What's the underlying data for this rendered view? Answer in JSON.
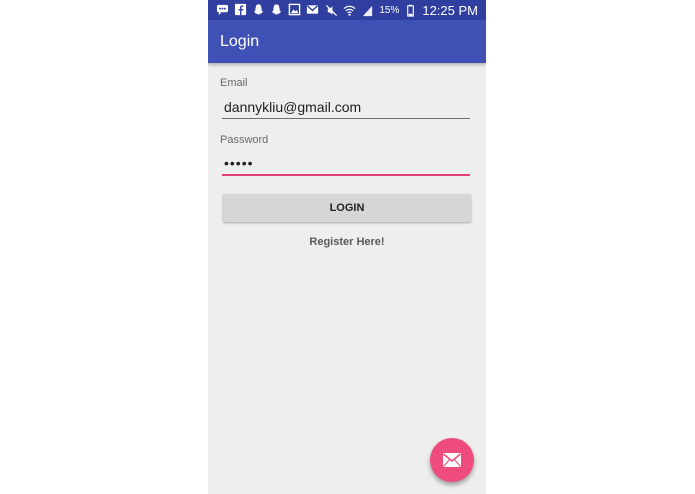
{
  "status_bar": {
    "battery": "15%",
    "time": "12:25 PM",
    "left_icons": [
      "messages-icon",
      "facebook-icon",
      "snapchat-icon",
      "snapchat-icon",
      "gallery-icon",
      "gmail-icon"
    ],
    "right_icons": [
      "mute-icon",
      "wifi-icon",
      "signal-icon",
      "battery-icon"
    ]
  },
  "app_bar": {
    "title": "Login",
    "color": "#3f51b5"
  },
  "form": {
    "email_label": "Email",
    "email_value": "dannykliu@gmail.com",
    "password_label": "Password",
    "password_value": "•••••",
    "login_label": "LOGIN",
    "register_label": "Register Here!"
  },
  "fab": {
    "icon": "mail-icon",
    "color": "#ef4c7e"
  }
}
